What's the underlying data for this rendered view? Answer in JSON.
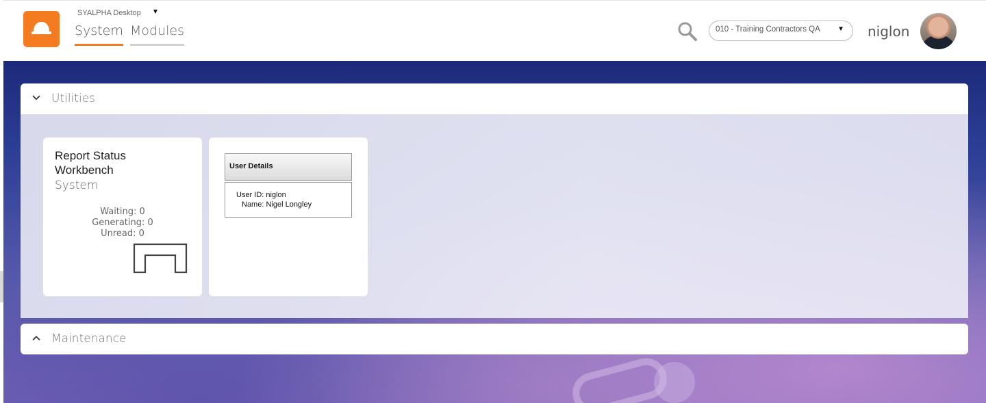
{
  "header": {
    "desktop_name": "SYALPHA Desktop",
    "caret": "▼",
    "tabs": [
      {
        "label": "System",
        "active": true
      },
      {
        "label": "Modules",
        "active": false
      }
    ],
    "company_select": {
      "value": "010 - Training Contractors QA",
      "caret": "▼"
    },
    "username": "niglon",
    "accent_color": "#f47b20",
    "logo_icon": "hard-hat-icon",
    "search_icon": "search-icon"
  },
  "panels": {
    "utilities": {
      "title": "Utilities",
      "expanded": true,
      "icon": "chevron-down-icon"
    },
    "maintenance": {
      "title": "Maintenance",
      "expanded": false,
      "icon": "chevron-up-icon"
    }
  },
  "tiles": {
    "report_status": {
      "title": "Report Status Workbench",
      "subtitle": "System",
      "waiting": "Waiting: 0",
      "generating": "Generating: 0",
      "unread": "Unread: 0",
      "icon": "inbox-tray-icon"
    },
    "user_details": {
      "header": "User Details",
      "user_id": "User ID: niglon",
      "name": "Name: Nigel Longley"
    }
  }
}
